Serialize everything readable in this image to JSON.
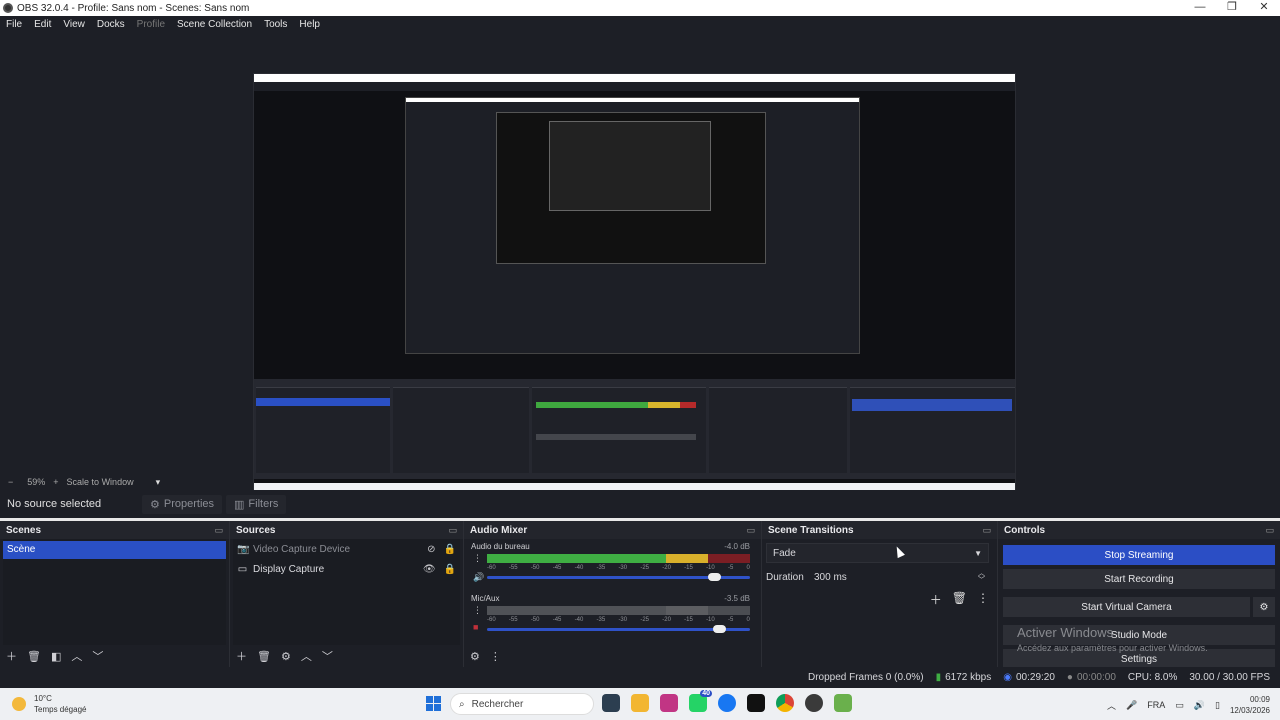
{
  "window": {
    "title": "OBS 32.0.4 - Profile: Sans nom - Scenes: Sans nom",
    "minimize": "—",
    "maximize": "❐",
    "close": "✕"
  },
  "menu": [
    "File",
    "Edit",
    "View",
    "Docks",
    "Profile",
    "Scene Collection",
    "Tools",
    "Help"
  ],
  "preview_controls": {
    "minus": "−",
    "zoom": "59%",
    "plus": "+",
    "scale": "Scale to Window",
    "dropdown": "▾"
  },
  "source_bar": {
    "no_source": "No source selected",
    "properties": "Properties",
    "filters": "Filters"
  },
  "scenes": {
    "header": "Scenes",
    "items": [
      "Scène"
    ]
  },
  "sources": {
    "header": "Sources",
    "items": [
      {
        "name": "Video Capture Device",
        "visible": false
      },
      {
        "name": "Display Capture",
        "visible": true
      }
    ]
  },
  "mixer": {
    "header": "Audio Mixer",
    "channels": [
      {
        "name": "Audio du bureau",
        "db": "-4.0 dB",
        "level": 0.92
      },
      {
        "name": "Mic/Aux",
        "db": "-3.5 dB",
        "level": 0.0
      }
    ],
    "ticks": [
      "-60",
      "-55",
      "-50",
      "-45",
      "-40",
      "-35",
      "-30",
      "-25",
      "-20",
      "-15",
      "-10",
      "-5",
      "0"
    ]
  },
  "transitions": {
    "header": "Scene Transitions",
    "selected": "Fade",
    "duration_label": "Duration",
    "duration": "300 ms"
  },
  "controls": {
    "header": "Controls",
    "stop_streaming": "Stop Streaming",
    "start_recording": "Start Recording",
    "start_virtual_camera": "Start Virtual Camera",
    "studio_mode": "Studio Mode",
    "settings": "Settings"
  },
  "watermark": {
    "line1": "Activer Windows",
    "line2": "Accédez aux paramètres pour activer Windows."
  },
  "status": {
    "dropped": "Dropped Frames 0 (0.0%)",
    "kbps": "6172 kbps",
    "stream_time": "00:29:20",
    "rec_time": "00:00:00",
    "cpu": "CPU: 8.0%",
    "fps": "30.00 / 30.00 FPS"
  },
  "taskbar": {
    "temp": "10°C",
    "weather": "Temps dégagé",
    "search": "Rechercher",
    "lang": "FRA",
    "time": "00:09",
    "date": "12/03/2026",
    "whatsapp_badge": "40"
  },
  "colors": {
    "accent": "#2b4ec5",
    "bg": "#1d1f26",
    "meter_green": "#3fae43",
    "meter_yellow": "#d9b02b",
    "meter_red": "#7b1e24"
  }
}
